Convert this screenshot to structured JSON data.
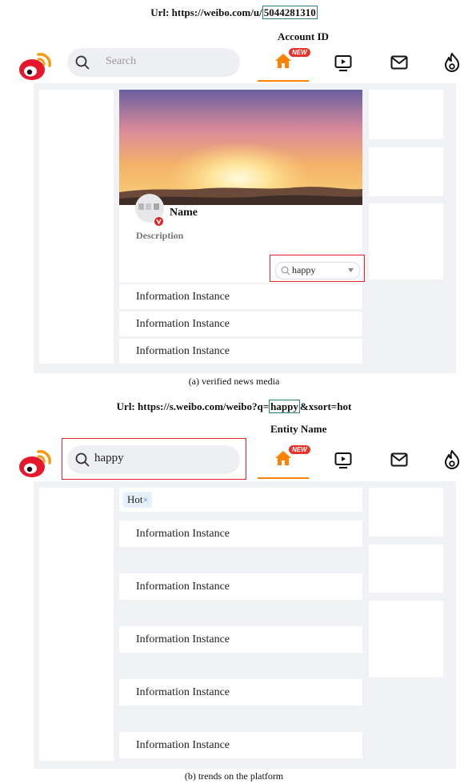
{
  "top": {
    "url_prefix": "Url: https://weibo.com/u/",
    "url_id": "5044281310",
    "annotation": "Account ID",
    "search_placeholder": "Search",
    "new_badge": "NEW",
    "banner_avatar_alt": "",
    "profile": {
      "name": "Name",
      "description": "Description"
    },
    "filter_value": "happy",
    "items": [
      "Information Instance",
      "Information Instance",
      "Information Instance"
    ],
    "caption": "(a) verified news media"
  },
  "bottom": {
    "url_prefix": "Url: https://s.weibo.com/weibo?q=",
    "url_entity": "happy",
    "url_suffix": "&xsort=hot",
    "annotation": "Entity Name",
    "search_value": "happy",
    "new_badge": "NEW",
    "tag_label": "Hot",
    "tag_close": "×",
    "items": [
      "Information Instance",
      "Information Instance",
      "Information Instance",
      "Information Instance",
      "Information Instance"
    ],
    "caption": "(b) trends on the platform"
  },
  "colors": {
    "brand_orange": "#ff8200",
    "highlight_red": "#e0262b",
    "url_box": "#2e7d7d",
    "panel_bg": "#f1f2f5"
  },
  "icons": [
    "weibo-logo-icon",
    "search-icon",
    "home-icon",
    "video-icon",
    "mail-icon",
    "hot-flame-icon",
    "dropdown-caret-icon",
    "verified-v-icon"
  ]
}
